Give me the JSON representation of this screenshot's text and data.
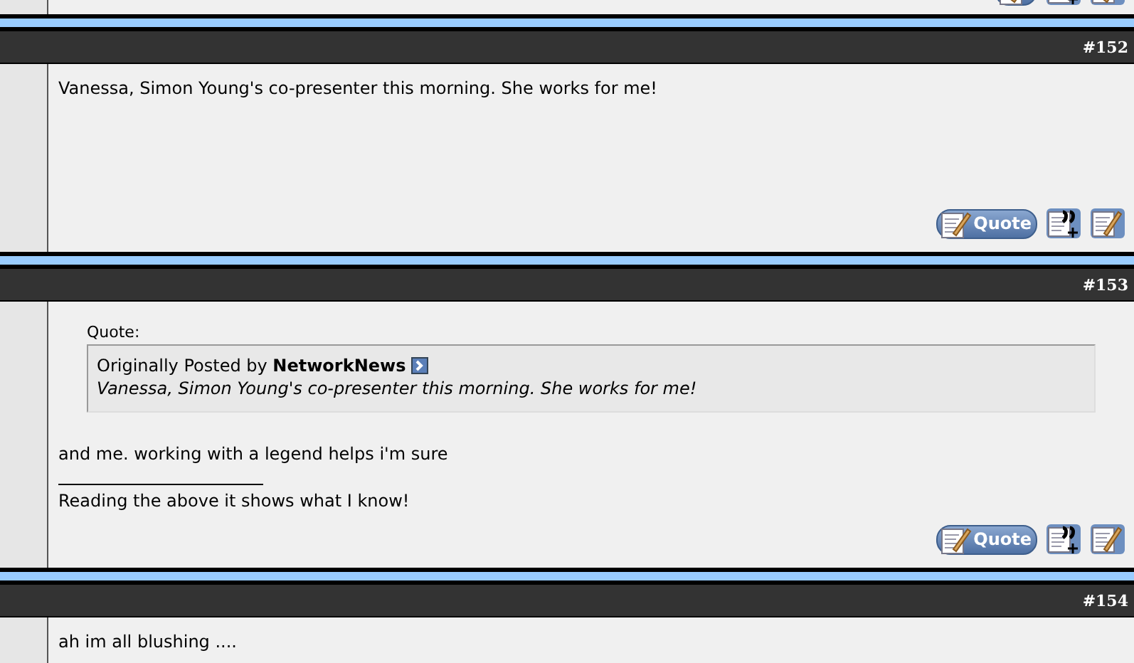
{
  "previous_post": {
    "buttons": [
      {
        "kind": "quote"
      },
      {
        "kind": "multiquote"
      },
      {
        "kind": "edit"
      }
    ]
  },
  "posts": [
    {
      "number": "#152",
      "blocks": [
        {
          "kind": "message",
          "text": "Vanessa, Simon Young's co-presenter this morning. She works for me!"
        }
      ],
      "buttons": [
        {
          "kind": "quote",
          "label": "Quote"
        },
        {
          "kind": "multiquote"
        },
        {
          "kind": "edit"
        }
      ]
    },
    {
      "number": "#153",
      "blocks": [
        {
          "kind": "quote",
          "label": "Quote:",
          "byline": "Originally Posted by **NetworkNews**",
          "text": "Vanessa, Simon Young's co-presenter this morning. She works for me!"
        },
        {
          "kind": "message",
          "text": "and me. working with a legend helps i'm sure"
        },
        {
          "kind": "signature",
          "text": "Reading the above it shows what I know!"
        }
      ],
      "buttons": [
        {
          "kind": "quote",
          "label": "Quote"
        },
        {
          "kind": "multiquote"
        },
        {
          "kind": "edit"
        }
      ]
    },
    {
      "number": "#154",
      "blocks": [
        {
          "kind": "message",
          "text": "ah im all blushing ...."
        }
      ]
    }
  ]
}
